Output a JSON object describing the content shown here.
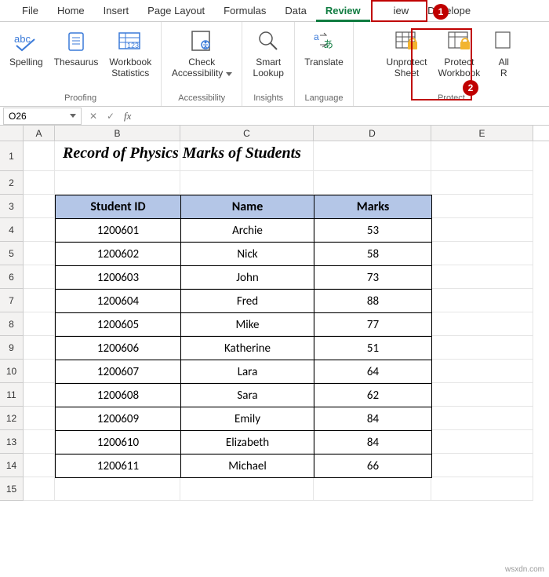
{
  "tabs": {
    "file": "File",
    "home": "Home",
    "insert": "Insert",
    "page_layout": "Page Layout",
    "formulas": "Formulas",
    "data": "Data",
    "review": "Review",
    "view_partial": "iew",
    "developer_partial": "Develope"
  },
  "ribbon": {
    "proofing": {
      "label": "Proofing",
      "spelling": "Spelling",
      "thesaurus": "Thesaurus",
      "stats_l1": "Workbook",
      "stats_l2": "Statistics"
    },
    "accessibility": {
      "label": "Accessibility",
      "check_l1": "Check",
      "check_l2": "Accessibility"
    },
    "insights": {
      "label": "Insights",
      "smart_l1": "Smart",
      "smart_l2": "Lookup"
    },
    "language": {
      "label": "Language",
      "translate": "Translate"
    },
    "protect": {
      "label": "Protect",
      "unprotect_l1": "Unprotect",
      "unprotect_l2": "Sheet",
      "protectwb_l1": "Protect",
      "protectwb_l2": "Workbook",
      "allow_l1": "All",
      "allow_l2": "R"
    }
  },
  "namebox": {
    "value": "O26"
  },
  "fx": {
    "cancel": "✕",
    "check": "✓",
    "label": "fx"
  },
  "colheads": {
    "A": "A",
    "B": "B",
    "C": "C",
    "D": "D",
    "E": "E"
  },
  "rowlabels": [
    "1",
    "2",
    "3",
    "4",
    "5",
    "6",
    "7",
    "8",
    "9",
    "10",
    "11",
    "12",
    "13",
    "14",
    "15"
  ],
  "sheet": {
    "title": "Record of Physics Marks of Students",
    "headers": {
      "id": "Student ID",
      "name": "Name",
      "marks": "Marks"
    },
    "rows": [
      {
        "id": "1200601",
        "name": "Archie",
        "marks": "53"
      },
      {
        "id": "1200602",
        "name": "Nick",
        "marks": "58"
      },
      {
        "id": "1200603",
        "name": "John",
        "marks": "73"
      },
      {
        "id": "1200604",
        "name": "Fred",
        "marks": "88"
      },
      {
        "id": "1200605",
        "name": "Mike",
        "marks": "77"
      },
      {
        "id": "1200606",
        "name": "Katherine",
        "marks": "51"
      },
      {
        "id": "1200607",
        "name": "Lara",
        "marks": "64"
      },
      {
        "id": "1200608",
        "name": "Sara",
        "marks": "62"
      },
      {
        "id": "1200609",
        "name": "Emily",
        "marks": "84"
      },
      {
        "id": "1200610",
        "name": "Elizabeth",
        "marks": "84"
      },
      {
        "id": "1200611",
        "name": "Michael",
        "marks": "66"
      }
    ]
  },
  "callouts": {
    "n1": "1",
    "n2": "2"
  },
  "watermark": "wsxdn.com"
}
